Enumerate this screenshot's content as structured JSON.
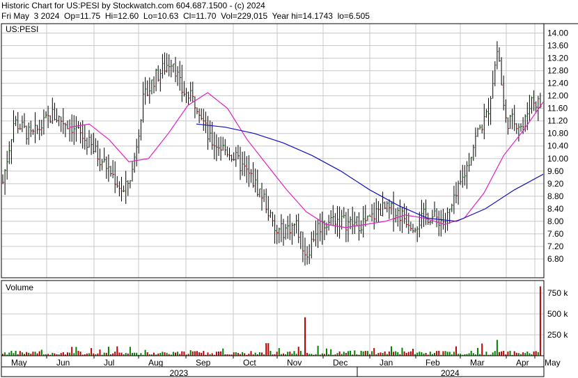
{
  "header": {
    "line1": "Historic Chart for US:PESI by Stockwatch.com 604.687.1500 - (c) 2024",
    "line2": "Fri May  3 2024  Op=11.75  Hi=12.60  Lo=10.63  Cl=11.70  Vol=229,015  Year hi=14.1743  lo=6.505"
  },
  "chart_data": {
    "type": "line",
    "symbol": "US:PESI",
    "price_axis": {
      "ticks": [
        "14.00",
        "13.60",
        "13.20",
        "12.80",
        "12.40",
        "12.00",
        "11.60",
        "11.20",
        "10.80",
        "10.40",
        "10.00",
        "9.60",
        "9.20",
        "8.80",
        "8.40",
        "8.00",
        "7.60",
        "7.20",
        "6.80"
      ],
      "ylim": [
        6.2,
        14.3
      ]
    },
    "volume_panel": {
      "label": "Volume",
      "ticks": [
        "750 k",
        "500 k",
        "250 k"
      ],
      "ylim": [
        0,
        900000
      ]
    },
    "x_axis": {
      "months": [
        "May",
        "Jun",
        "Jul",
        "Aug",
        "Sep",
        "Oct",
        "Nov",
        "Dec",
        "Jan",
        "Feb",
        "Mar",
        "Apr",
        "May"
      ],
      "years": [
        "2023",
        "2024"
      ]
    },
    "grid": true,
    "colors": {
      "up": "#008000",
      "down": "#c00000",
      "ma_short": "#e020c0",
      "ma_long": "#1010c0",
      "grid": "#c8c8c8",
      "frame": "#000000"
    },
    "series": [
      {
        "role": "close",
        "month_points": [
          [
            "May",
            9.0
          ],
          [
            "Jun",
            11.1
          ],
          [
            "Jul",
            9.9
          ],
          [
            "Jul-late",
            8.9
          ],
          [
            "Aug",
            12.5
          ],
          [
            "Aug-mid",
            13.2
          ],
          [
            "Sep",
            11.4
          ],
          [
            "Sep-mid",
            10.6
          ],
          [
            "Oct",
            10.3
          ],
          [
            "Oct-late",
            8.9
          ],
          [
            "Nov",
            7.4
          ],
          [
            "Nov-late",
            6.8
          ],
          [
            "Dec",
            8.0
          ],
          [
            "Jan",
            7.9
          ],
          [
            "Jan-mid",
            8.3
          ],
          [
            "Feb",
            7.9
          ],
          [
            "Mar",
            8.5
          ],
          [
            "Mar-mid",
            10.5
          ],
          [
            "Apr",
            13.3
          ],
          [
            "Apr-mid",
            11.0
          ],
          [
            "May",
            11.7
          ]
        ]
      },
      {
        "role": "ma_short",
        "values": [
          11.0,
          11.1,
          10.6,
          9.9,
          10.0,
          10.8,
          11.7,
          12.1,
          11.6,
          10.6,
          9.8,
          9.0,
          8.3,
          7.9,
          7.8,
          7.9,
          8.0,
          8.2,
          8.1,
          7.9,
          8.1,
          8.9,
          10.1,
          10.9,
          11.8
        ]
      },
      {
        "role": "ma_long",
        "values": [
          11.1,
          11.0,
          10.8,
          10.5,
          10.1,
          9.6,
          9.0,
          8.5,
          8.1,
          8.0,
          8.4,
          9.0,
          9.5
        ]
      }
    ]
  }
}
